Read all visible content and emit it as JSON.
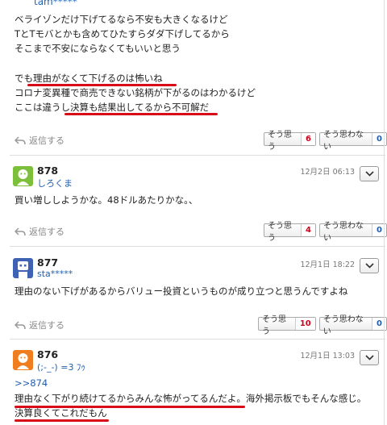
{
  "comment_top": {
    "user": "tam*****",
    "lines": [
      "ベライゾンだけ下げてるなら不安も大きくなるけど",
      "TとTモバとかも含めてひたすらダダ下げしてるから",
      "そこまで不安にならなくてもいいと思う",
      "",
      "でも理由がなくて下げるのは怖いね",
      "コロナ変異種で商売できない銘柄が下がるのはわかるけど",
      "ここは違うし決算も結果出してるから不可解だ"
    ],
    "reply": "返信する",
    "agree_label": "そう思う",
    "agree_count": "6",
    "disagree_label": "そう思わない",
    "disagree_count": "0"
  },
  "comment_878": {
    "number": "878",
    "user": "しろくま",
    "date": "12月2日 06:13",
    "text": "買い増ししようかな。48ドルあたりかな。、",
    "reply": "返信する",
    "agree_label": "そう思う",
    "agree_count": "4",
    "disagree_label": "そう思わない",
    "disagree_count": "0"
  },
  "comment_877": {
    "number": "877",
    "user": "sta*****",
    "date": "12月1日 18:22",
    "text": "理由のない下げがあるからバリュー投資というものが成り立つと思うんですよね",
    "reply": "返信する",
    "agree_label": "そう思う",
    "agree_count": "10",
    "disagree_label": "そう思わない",
    "disagree_count": "0"
  },
  "comment_876": {
    "number": "876",
    "user": "(;-_-) =3 ﾌｩ",
    "date": "12月1日 13:03",
    "anchor": ">>874",
    "line1": "理由なく下がり続けてるからみんな怖がってるんだよ。海外掲示板でもそんな感じ。",
    "line2": "決算良くてこれだもん"
  },
  "colors": {
    "link": "#1f5fb0",
    "agree_count": "#d0021b",
    "disagree_count": "#1f5fb0",
    "highlight_underline": "#d80c18",
    "avatar_878": "#7cbf3a",
    "avatar_877": "#3f62b5",
    "avatar_876": "#f07d1e"
  },
  "icons": {
    "reply": "reply-arrow-icon",
    "menu": "chevron-down-icon",
    "avatar": "user-avatar-icon"
  }
}
